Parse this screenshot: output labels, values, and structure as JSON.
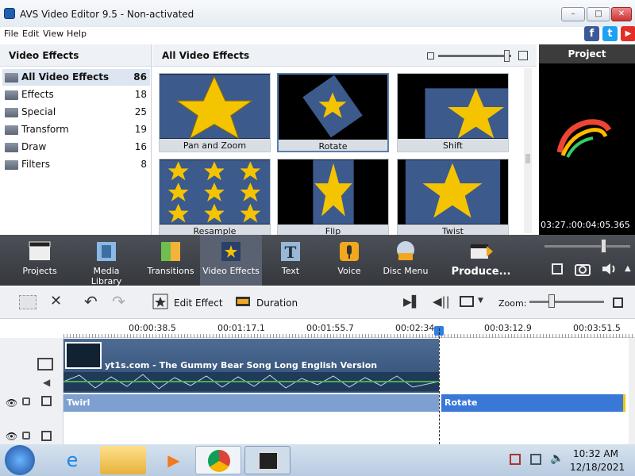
{
  "window": {
    "title": "AVS Video Editor 9.5 - Non-activated",
    "min_glyph": "–",
    "max_glyph": "□",
    "close_glyph": "✕"
  },
  "menu": {
    "items": [
      "File",
      "Edit",
      "View",
      "Help"
    ]
  },
  "social": {
    "facebook": "f",
    "twitter": "t",
    "youtube": "▶"
  },
  "left_panel": {
    "title": "Video Effects",
    "items": [
      {
        "label": "All Video Effects",
        "count": "86"
      },
      {
        "label": "Effects",
        "count": "18"
      },
      {
        "label": "Special",
        "count": "25"
      },
      {
        "label": "Transform",
        "count": "19"
      },
      {
        "label": "Draw",
        "count": "16"
      },
      {
        "label": "Filters",
        "count": "8"
      }
    ]
  },
  "center_panel": {
    "title": "All Video Effects",
    "thumb_size_level": 0.95,
    "effects": [
      "Pan and Zoom",
      "Rotate",
      "Shift",
      "Resample",
      "Flip",
      "Twist"
    ]
  },
  "preview": {
    "title": "Project",
    "timecode": "03:27.:00:04:05.365"
  },
  "toolbar": {
    "items": [
      "Projects",
      "Media Library",
      "Transitions",
      "Video Effects",
      "Text",
      "Voice",
      "Disc Menu",
      "Produce..."
    ]
  },
  "edit_toolbar": {
    "edit_effect": "Edit Effect",
    "duration": "Duration",
    "zoom_label": "Zoom:",
    "zoom_level": 0.3
  },
  "ruler": {
    "labels": [
      "00:00:38.5",
      "00:01:17.1",
      "00:01:55.7",
      "00:02:34.",
      "00:03:12.9",
      "00:03:51.5"
    ]
  },
  "timeline": {
    "clip_title": "yt1s.com - The Gummy Bear Song  Long English Version",
    "effect_twirl": "Twirl",
    "effect_rotate": "Rotate"
  },
  "taskbar": {
    "time": "10:32 AM",
    "date": "12/18/2021"
  },
  "colors": {
    "accent": "#3a78d8",
    "toolbar": "#3f4349",
    "star": "#f5c400"
  }
}
